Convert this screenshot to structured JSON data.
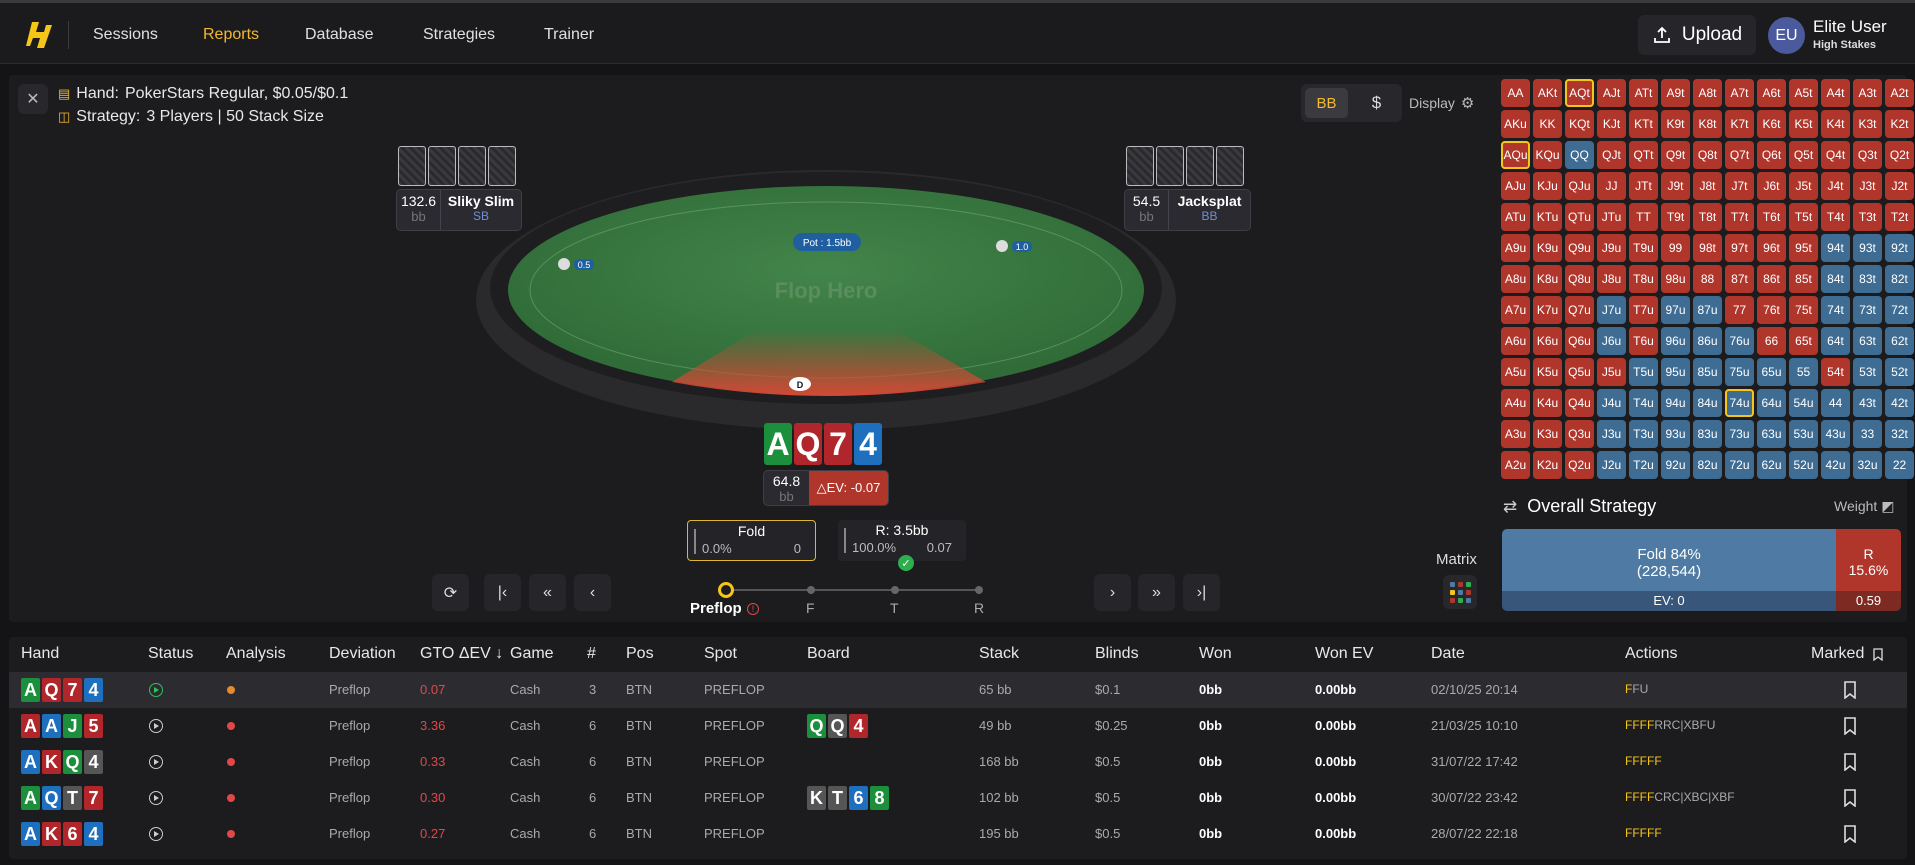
{
  "nav": {
    "items": [
      "Sessions",
      "Reports",
      "Database",
      "Strategies",
      "Trainer"
    ],
    "active": "Reports",
    "upload_label": "Upload",
    "user": {
      "initials": "EU",
      "name": "Elite User",
      "tier": "High Stakes"
    }
  },
  "hand_info": {
    "hand_label": "Hand:",
    "hand_value": "PokerStars Regular, $0.05/$0.1",
    "strategy_label": "Strategy:",
    "strategy_value": "3 Players | 50 Stack Size"
  },
  "unit_toggle": {
    "bb": "BB",
    "dollar": "$",
    "display": "Display"
  },
  "seats": {
    "left": {
      "stack": "132.6",
      "unit": "bb",
      "name": "Sliky Slim",
      "position": "SB"
    },
    "right": {
      "stack": "54.5",
      "unit": "bb",
      "name": "Jacksplat",
      "position": "BB"
    }
  },
  "table": {
    "pot": "Pot : 1.5bb",
    "sb_chip": "0.5",
    "bb_chip": "1.0",
    "watermark": "Flop Hero",
    "felt_color": "#3c7a3f"
  },
  "hero": {
    "cards": [
      {
        "rank": "A",
        "color": "#1c8f3c"
      },
      {
        "rank": "Q",
        "color": "#b0262b"
      },
      {
        "rank": "7",
        "color": "#b0262b"
      },
      {
        "rank": "4",
        "color": "#1f6fbf"
      }
    ],
    "stack": "64.8",
    "unit": "bb",
    "ev": "△EV: -0.07"
  },
  "actions": [
    {
      "label": "Fold",
      "pct": "0.0%",
      "ev": "0"
    },
    {
      "label": "R: 3.5bb",
      "pct": "100.0%",
      "ev": "0.07"
    }
  ],
  "streets": [
    "Preflop",
    "F",
    "T",
    "R"
  ],
  "matrix_label": "Matrix",
  "range": {
    "rows": [
      [
        "AA",
        "AKt",
        "AQt",
        "AJt",
        "ATt",
        "A9t",
        "A8t",
        "A7t",
        "A6t",
        "A5t",
        "A4t",
        "A3t",
        "A2t"
      ],
      [
        "AKu",
        "KK",
        "KQt",
        "KJt",
        "KTt",
        "K9t",
        "K8t",
        "K7t",
        "K6t",
        "K5t",
        "K4t",
        "K3t",
        "K2t"
      ],
      [
        "AQu",
        "KQu",
        "QQ",
        "QJt",
        "QTt",
        "Q9t",
        "Q8t",
        "Q7t",
        "Q6t",
        "Q5t",
        "Q4t",
        "Q3t",
        "Q2t"
      ],
      [
        "AJu",
        "KJu",
        "QJu",
        "JJ",
        "JTt",
        "J9t",
        "J8t",
        "J7t",
        "J6t",
        "J5t",
        "J4t",
        "J3t",
        "J2t"
      ],
      [
        "ATu",
        "KTu",
        "QTu",
        "JTu",
        "TT",
        "T9t",
        "T8t",
        "T7t",
        "T6t",
        "T5t",
        "T4t",
        "T3t",
        "T2t"
      ],
      [
        "A9u",
        "K9u",
        "Q9u",
        "J9u",
        "T9u",
        "99",
        "98t",
        "97t",
        "96t",
        "95t",
        "94t",
        "93t",
        "92t"
      ],
      [
        "A8u",
        "K8u",
        "Q8u",
        "J8u",
        "T8u",
        "98u",
        "88",
        "87t",
        "86t",
        "85t",
        "84t",
        "83t",
        "82t"
      ],
      [
        "A7u",
        "K7u",
        "Q7u",
        "J7u",
        "T7u",
        "97u",
        "87u",
        "77",
        "76t",
        "75t",
        "74t",
        "73t",
        "72t"
      ],
      [
        "A6u",
        "K6u",
        "Q6u",
        "J6u",
        "T6u",
        "96u",
        "86u",
        "76u",
        "66",
        "65t",
        "64t",
        "63t",
        "62t"
      ],
      [
        "A5u",
        "K5u",
        "Q5u",
        "J5u",
        "T5u",
        "95u",
        "85u",
        "75u",
        "65u",
        "55",
        "54t",
        "53t",
        "52t"
      ],
      [
        "A4u",
        "K4u",
        "Q4u",
        "J4u",
        "T4u",
        "94u",
        "84u",
        "74u",
        "64u",
        "54u",
        "44",
        "43t",
        "42t"
      ],
      [
        "A3u",
        "K3u",
        "Q3u",
        "J3u",
        "T3u",
        "93u",
        "83u",
        "73u",
        "63u",
        "53u",
        "43u",
        "33",
        "32t"
      ],
      [
        "A2u",
        "K2u",
        "Q2u",
        "J2u",
        "T2u",
        "92u",
        "82u",
        "72u",
        "62u",
        "52u",
        "42u",
        "32u",
        "22"
      ]
    ],
    "actions": [
      "FFFFFFFFFFFFF",
      "FFFFFFFFFFFFF",
      "FFRFFFFFFFFFF",
      "FFFFFFFFFFFFF",
      "FFFFFFFFFFFFF",
      "FFFFFFFFFFRRR",
      "FFFFFFFFFFRRR",
      "FFFRFRRFFFRRR",
      "FFFRFRRRFFRRR",
      "FFFFRRRRRRFRR",
      "FFFRRRRRRRRRR",
      "FFFRRRRRRRRRR",
      "FFFRRRRRRRRRR"
    ],
    "selected": [
      "AQt",
      "AQu",
      "74u"
    ],
    "fold_color": "#b0362c",
    "raise_color": "#3f6c93"
  },
  "overall": {
    "title": "Overall Strategy",
    "weight": "Weight",
    "fold_line1": "Fold 84%",
    "fold_line2": "(228,544)",
    "raise_line1": "R",
    "raise_line2": "15.6%",
    "fold_ev": "EV: 0",
    "raise_ev": "0.59"
  },
  "hands_table": {
    "headers": [
      "Hand",
      "Status",
      "Analysis",
      "Deviation",
      "GTO ΔEV ↓",
      "Game",
      "#",
      "Pos",
      "Spot",
      "Board",
      "Stack",
      "Blinds",
      "Won",
      "Won EV",
      "Date",
      "Actions",
      "Marked"
    ],
    "rows": [
      {
        "cards": [
          [
            "A",
            "#1c8f3c"
          ],
          [
            "Q",
            "#b0262b"
          ],
          [
            "7",
            "#b0262b"
          ],
          [
            "4",
            "#1f6fbf"
          ]
        ],
        "status": "green",
        "analysis": "#e8892e",
        "deviation": "Preflop",
        "dev": "0.07",
        "game": "Cash",
        "num": "3",
        "pos": "BTN",
        "spot": "PREFLOP",
        "board": [],
        "stack": "65 bb",
        "blinds": "$0.1",
        "won": "0bb",
        "won_ev": "0.00bb",
        "date": "02/10/25 20:14",
        "actions_hi": "F",
        "actions_rest": "FU"
      },
      {
        "cards": [
          [
            "A",
            "#b0262b"
          ],
          [
            "A",
            "#1f6fbf"
          ],
          [
            "J",
            "#1c8f3c"
          ],
          [
            "5",
            "#b0262b"
          ]
        ],
        "status": "white",
        "analysis": "#e0484a",
        "deviation": "Preflop",
        "dev": "3.36",
        "game": "Cash",
        "num": "6",
        "pos": "BTN",
        "spot": "PREFLOP",
        "board": [
          [
            "Q",
            "#1c8f3c"
          ],
          [
            "Q",
            "#555"
          ],
          [
            "4",
            "#b0262b"
          ]
        ],
        "stack": "49 bb",
        "blinds": "$0.25",
        "won": "0bb",
        "won_ev": "0.00bb",
        "date": "21/03/25 10:10",
        "actions_pre": "FFF",
        "actions_hi": "F",
        "actions_rest": "RRC|XBFU"
      },
      {
        "cards": [
          [
            "A",
            "#1f6fbf"
          ],
          [
            "K",
            "#b0262b"
          ],
          [
            "Q",
            "#1c8f3c"
          ],
          [
            "4",
            "#555"
          ]
        ],
        "status": "white",
        "analysis": "#e0484a",
        "deviation": "Preflop",
        "dev": "0.33",
        "game": "Cash",
        "num": "6",
        "pos": "BTN",
        "spot": "PREFLOP",
        "board": [],
        "stack": "168 bb",
        "blinds": "$0.5",
        "won": "0bb",
        "won_ev": "0.00bb",
        "date": "31/07/22 17:42",
        "actions_pre": "FFF",
        "actions_hi": "FF",
        "actions_rest": ""
      },
      {
        "cards": [
          [
            "A",
            "#1c8f3c"
          ],
          [
            "Q",
            "#1f6fbf"
          ],
          [
            "T",
            "#555"
          ],
          [
            "7",
            "#b0262b"
          ]
        ],
        "status": "white",
        "analysis": "#e0484a",
        "deviation": "Preflop",
        "dev": "0.30",
        "game": "Cash",
        "num": "6",
        "pos": "BTN",
        "spot": "PREFLOP",
        "board": [
          [
            "K",
            "#555"
          ],
          [
            "T",
            "#555"
          ],
          [
            "6",
            "#1f6fbf"
          ],
          [
            "8",
            "#1c8f3c"
          ]
        ],
        "stack": "102 bb",
        "blinds": "$0.5",
        "won": "0bb",
        "won_ev": "0.00bb",
        "date": "30/07/22 23:42",
        "actions_pre": "FFF",
        "actions_hi": "F",
        "actions_rest": "CRC|XBC|XBF"
      },
      {
        "cards": [
          [
            "A",
            "#1f6fbf"
          ],
          [
            "K",
            "#b0262b"
          ],
          [
            "6",
            "#b0262b"
          ],
          [
            "4",
            "#1f6fbf"
          ]
        ],
        "status": "white",
        "analysis": "#e0484a",
        "deviation": "Preflop",
        "dev": "0.27",
        "game": "Cash",
        "num": "6",
        "pos": "BTN",
        "spot": "PREFLOP",
        "board": [],
        "stack": "195 bb",
        "blinds": "$0.5",
        "won": "0bb",
        "won_ev": "0.00bb",
        "date": "28/07/22 22:18",
        "actions_pre": "FFF",
        "actions_hi": "FF",
        "actions_rest": ""
      }
    ]
  }
}
